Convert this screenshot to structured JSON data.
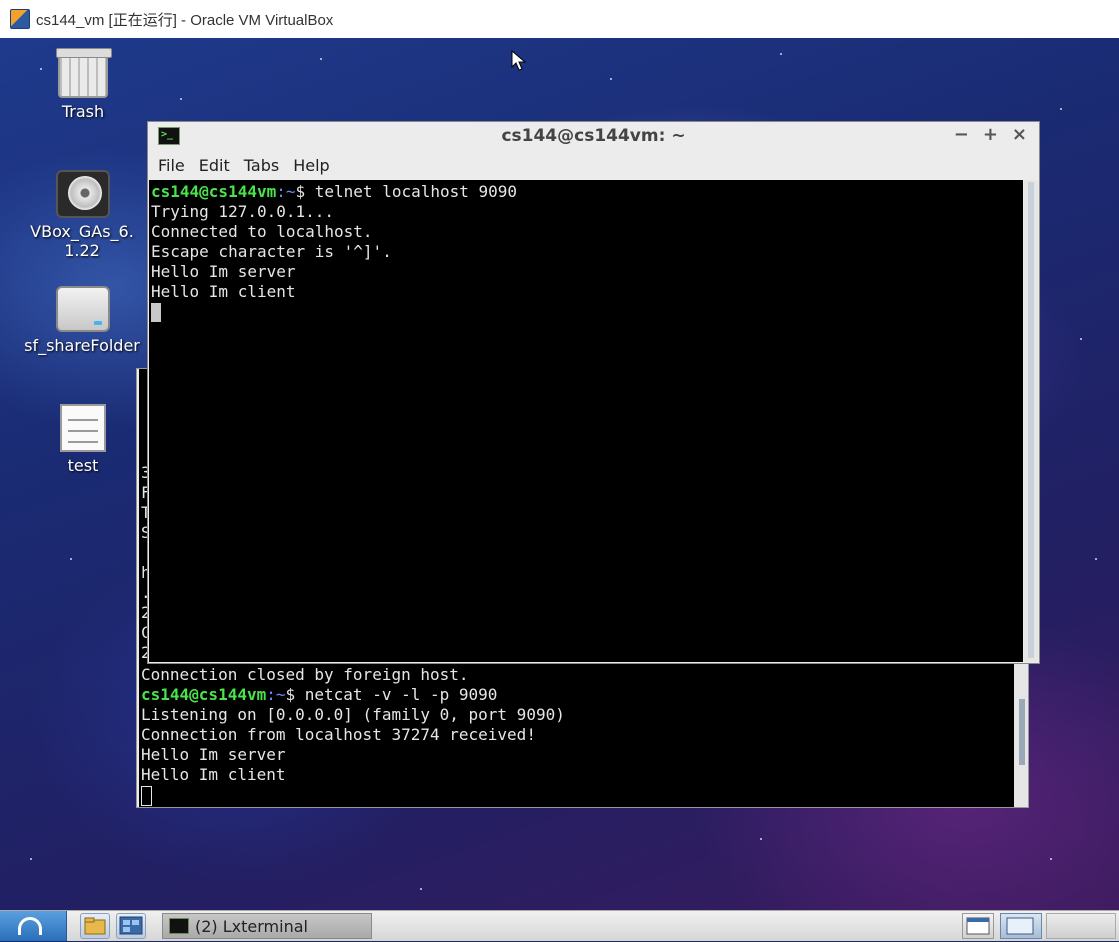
{
  "host": {
    "title": "cs144_vm [正在运行] - Oracle VM VirtualBox"
  },
  "desktop_icons": [
    {
      "label": "Trash",
      "icon": "trash-icon"
    },
    {
      "label": "VBox_GAs_6.1.22",
      "icon": "cd-icon"
    },
    {
      "label": "sf_shareFolder",
      "icon": "drive-icon"
    },
    {
      "label": "test",
      "icon": "document-icon"
    }
  ],
  "front_terminal": {
    "title": "cs144@cs144vm: ~",
    "menu": [
      "File",
      "Edit",
      "Tabs",
      "Help"
    ],
    "prompt_user": "cs144@cs144vm",
    "prompt_path": ":~",
    "prompt_symbol": "$ ",
    "command": "telnet localhost 9090",
    "output": [
      "Trying 127.0.0.1...",
      "Connected to localhost.",
      "Escape character is '^]'.",
      "Hello Im server",
      "Hello Im client"
    ],
    "controls": {
      "minimize": "−",
      "maximize": "+",
      "close": "×"
    }
  },
  "back_terminal": {
    "edge_chars": [
      "3",
      "F",
      "T",
      "S",
      "",
      "h",
      ".",
      "2",
      "C",
      "2"
    ],
    "pre_prompt": "Connection closed by foreign host.",
    "prompt_user": "cs144@cs144vm",
    "prompt_path": ":~",
    "prompt_symbol": "$ ",
    "command": "netcat -v -l -p 9090",
    "output": [
      "Listening on [0.0.0.0] (family 0, port 9090)",
      "Connection from localhost 37274 received!",
      "Hello Im server",
      "Hello Im client"
    ]
  },
  "taskbar": {
    "task_label": "(2) Lxterminal"
  },
  "colors": {
    "prompt_user": "#49e34a",
    "prompt_path": "#6b8cff",
    "terminal_bg": "#000000",
    "terminal_fg": "#e6e6e6"
  }
}
